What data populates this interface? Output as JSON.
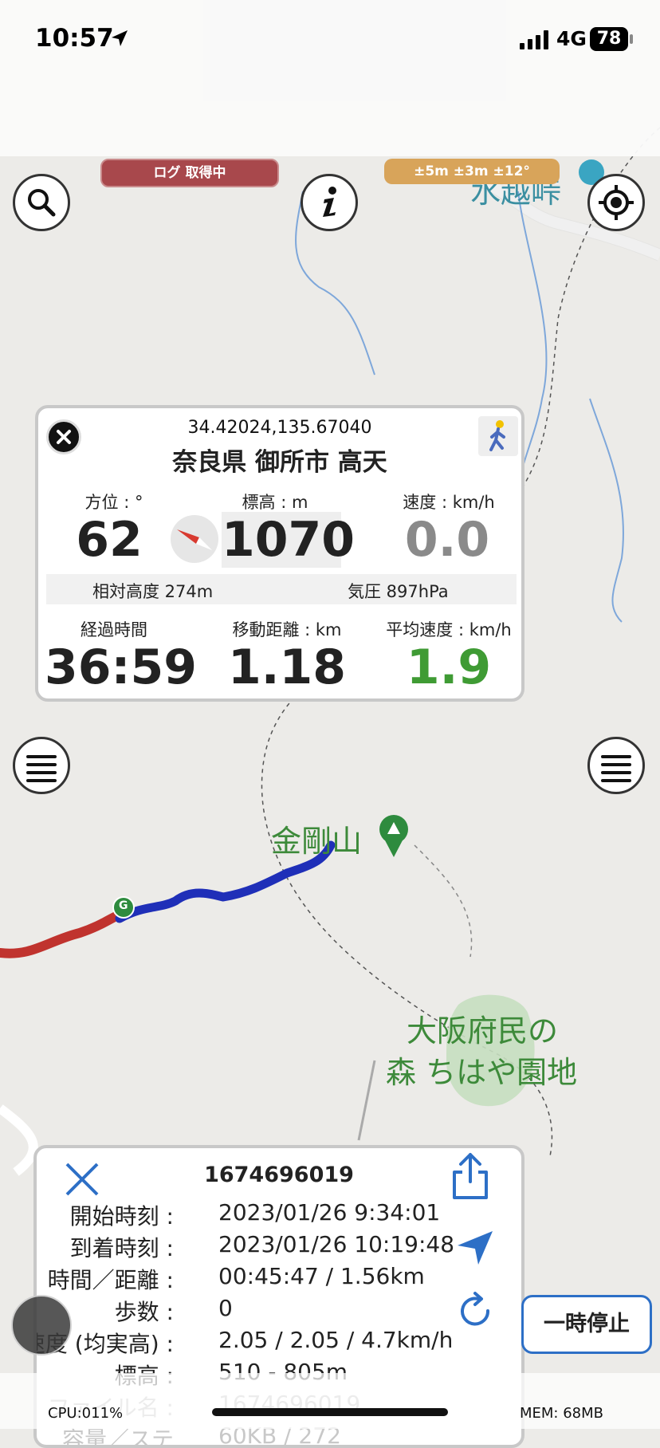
{
  "status_bar": {
    "time": "10:57",
    "network": "4G",
    "battery": "78"
  },
  "badges": {
    "log_status": "ログ 取得中",
    "accuracy": "±5m ±3m ±12°"
  },
  "map_labels": {
    "pass": "水越峠",
    "mountain": "金剛山",
    "park_line1": "大阪府民の",
    "park_line2": "森 ちはや園地"
  },
  "info_panel": {
    "coords": "34.42024,135.67040",
    "address": "奈良県 御所市 高天",
    "bearing_label": "方位 : °",
    "bearing_value": "62",
    "elevation_label": "標高 : m",
    "elevation_value": "1070",
    "speed_label": "速度 : km/h",
    "speed_value": "0.0",
    "relative_height": "相対高度 274m",
    "pressure": "気圧 897hPa",
    "elapsed_label": "経過時間",
    "elapsed_value": "36:59",
    "distance_label": "移動距離 : km",
    "distance_value": "1.18",
    "avg_speed_label": "平均速度 : km/h",
    "avg_speed_value": "1.9"
  },
  "track_panel": {
    "title": "1674696019",
    "rows": [
      {
        "key": "開始時刻 :",
        "value": "2023/01/26 9:34:01"
      },
      {
        "key": "到着時刻 :",
        "value": "2023/01/26 10:19:48"
      },
      {
        "key": "時間／距離 :",
        "value": "00:45:47 / 1.56km"
      },
      {
        "key": "歩数 :",
        "value": "0"
      },
      {
        "key": "速度 (均実高) :",
        "value": "2.05 / 2.05 / 4.7km/h"
      },
      {
        "key": "標高 :",
        "value": "510 - 805m"
      },
      {
        "key": "ファイル名 :",
        "value": "1674696019"
      },
      {
        "key": "容量／ステ",
        "value": "60KB / 272"
      }
    ]
  },
  "pause_button": "一時停止",
  "footer": {
    "cpu": "CPU:011%",
    "mem": "MEM: 68MB"
  },
  "colors": {
    "track_red": "#c0332e",
    "track_blue": "#1f2fb8",
    "avg_speed_green": "#3f9b34",
    "accent_blue": "#2d6fc6"
  }
}
